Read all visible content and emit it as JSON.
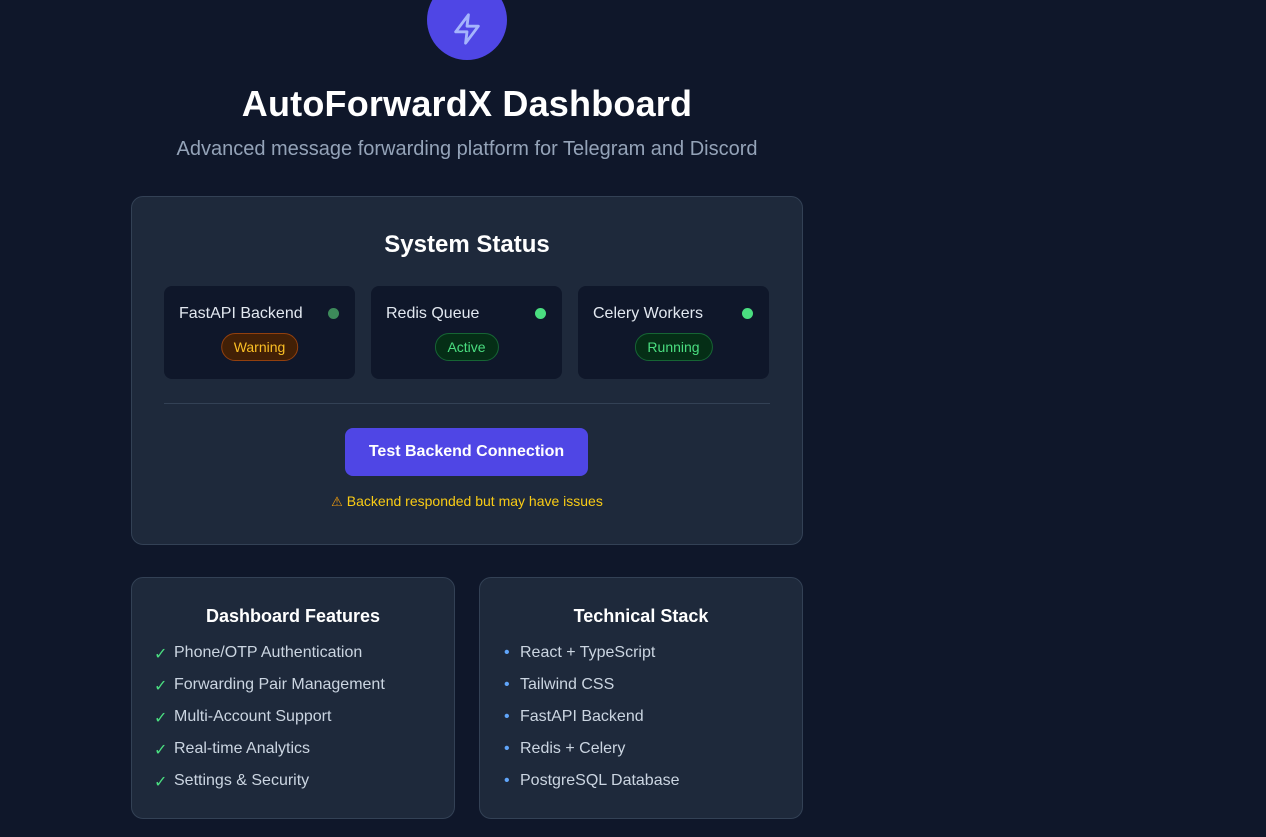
{
  "header": {
    "title": "AutoForwardX Dashboard",
    "subtitle": "Advanced message forwarding platform for Telegram and Discord",
    "logo_icon": "lightning-bolt-icon"
  },
  "status": {
    "title": "System Status",
    "services": [
      {
        "name": "FastAPI Backend",
        "badge": "Warning",
        "state": "warning",
        "dot_color": "#3d8a5a"
      },
      {
        "name": "Redis Queue",
        "badge": "Active",
        "state": "ok",
        "dot_color": "#4ade80"
      },
      {
        "name": "Celery Workers",
        "badge": "Running",
        "state": "ok",
        "dot_color": "#4ade80"
      }
    ],
    "test_button_label": "Test Backend Connection",
    "warning_icon": "⚠",
    "warning_message": "Backend responded but may have issues"
  },
  "features": {
    "title": "Dashboard Features",
    "check_glyph": "✓",
    "items": [
      "Phone/OTP Authentication",
      "Forwarding Pair Management",
      "Multi-Account Support",
      "Real-time Analytics",
      "Settings & Security"
    ]
  },
  "stack": {
    "title": "Technical Stack",
    "bullet_glyph": "•",
    "items": [
      "React + TypeScript",
      "Tailwind CSS",
      "FastAPI Backend",
      "Redis + Celery",
      "PostgreSQL Database"
    ]
  },
  "colors": {
    "background": "#0f172a",
    "card": "#1e293b",
    "accent": "#4f46e5",
    "success": "#4ade80",
    "warning": "#fbbf24"
  }
}
